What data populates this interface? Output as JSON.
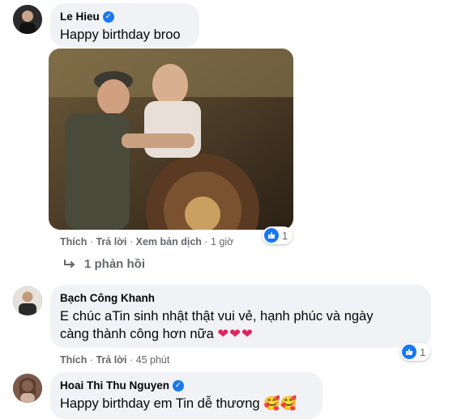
{
  "comments": [
    {
      "author": "Le Hieu",
      "verified": true,
      "text": "Happy birthday broo",
      "actions": {
        "like": "Thích",
        "reply": "Trả lời",
        "translate": "Xem bản dịch",
        "time": "1 giờ"
      },
      "reaction": {
        "icon": "like-icon",
        "count": "1"
      }
    },
    {
      "author": "Bạch Công Khanh",
      "verified": false,
      "text_line1": "E chúc aTin sinh nhật thật vui vẻ, hạnh phúc và ngày",
      "text_line2": "càng thành công hơn nữa",
      "emoji": "❤❤❤",
      "actions": {
        "like": "Thích",
        "reply": "Trả lời",
        "time": "45 phút"
      },
      "reaction": {
        "icon": "like-icon",
        "count": "1"
      }
    },
    {
      "author": "Hoai Thi Thu Nguyen",
      "verified": true,
      "text": "Happy birthday em Tin dễ thương",
      "emoji": "🥰🥰"
    }
  ],
  "replies": {
    "label": "1 phản hồi",
    "icon": "reply-arrow-icon"
  },
  "colors": {
    "accent": "#1877f2",
    "bubble": "#f0f2f5",
    "muted": "#65676b"
  }
}
